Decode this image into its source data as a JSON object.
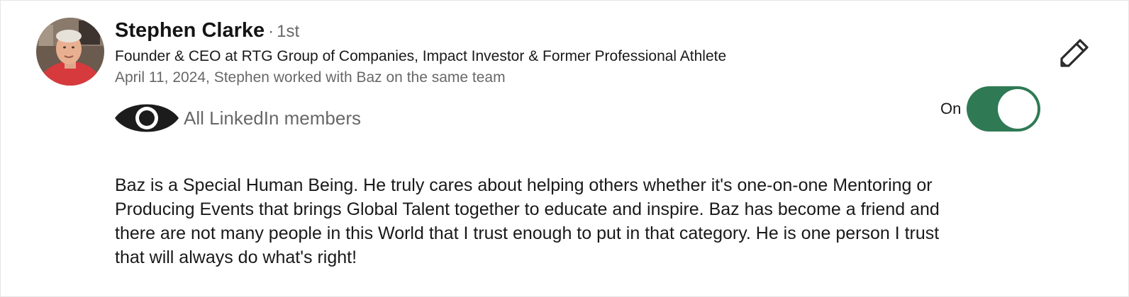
{
  "recommendation": {
    "name": "Stephen Clarke",
    "degree_separator": "·",
    "degree": "1st",
    "headline": "Founder & CEO at RTG Group of Companies, Impact Investor & Former Professional Athlete",
    "meta": "April 11, 2024, Stephen worked with Baz on the same team",
    "visibility_label": "All LinkedIn members",
    "visibility_icon": "eye-icon",
    "toggle_label": "On",
    "toggle_state": true,
    "toggle_color": "#2f7a54",
    "edit_icon": "pencil-icon",
    "text": "Baz is a Special Human Being. He truly cares about helping others whether it's one-on-one Mentoring or Producing Events that brings Global Talent together to educate and inspire. Baz has become a friend and there are not many people in this World that I trust enough to put in that category. He is one person I trust that will always do what's right!"
  }
}
